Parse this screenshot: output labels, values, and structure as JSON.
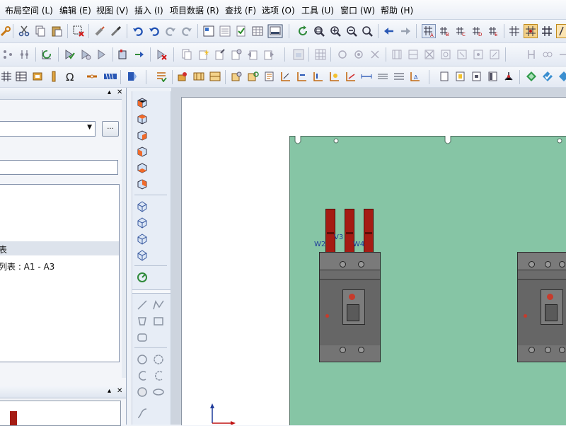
{
  "menu": [
    {
      "id": "layout",
      "label": "布局空间 (L)"
    },
    {
      "id": "edit",
      "label": "编辑 (E)"
    },
    {
      "id": "view",
      "label": "视图 (V)"
    },
    {
      "id": "insert",
      "label": "插入 (I)"
    },
    {
      "id": "project-data",
      "label": "项目数据 (R)"
    },
    {
      "id": "find",
      "label": "查找 (F)"
    },
    {
      "id": "options",
      "label": "选项 (O)"
    },
    {
      "id": "tools",
      "label": "工具 (U)"
    },
    {
      "id": "window",
      "label": "窗口 (W)"
    },
    {
      "id": "help",
      "label": "帮助 (H)"
    }
  ],
  "left_panel": {
    "browse_button": "...",
    "tree_item_1": "表",
    "tree_item_2": "列表 : A1 - A3"
  },
  "canvas": {
    "terminal_labels": [
      "W2",
      "V3",
      "W4"
    ]
  },
  "colors": {
    "plate": "#86c5a5",
    "busbar": "#a51c14",
    "breaker": "#6c6c6c",
    "window_bg": "#eef2f8"
  }
}
